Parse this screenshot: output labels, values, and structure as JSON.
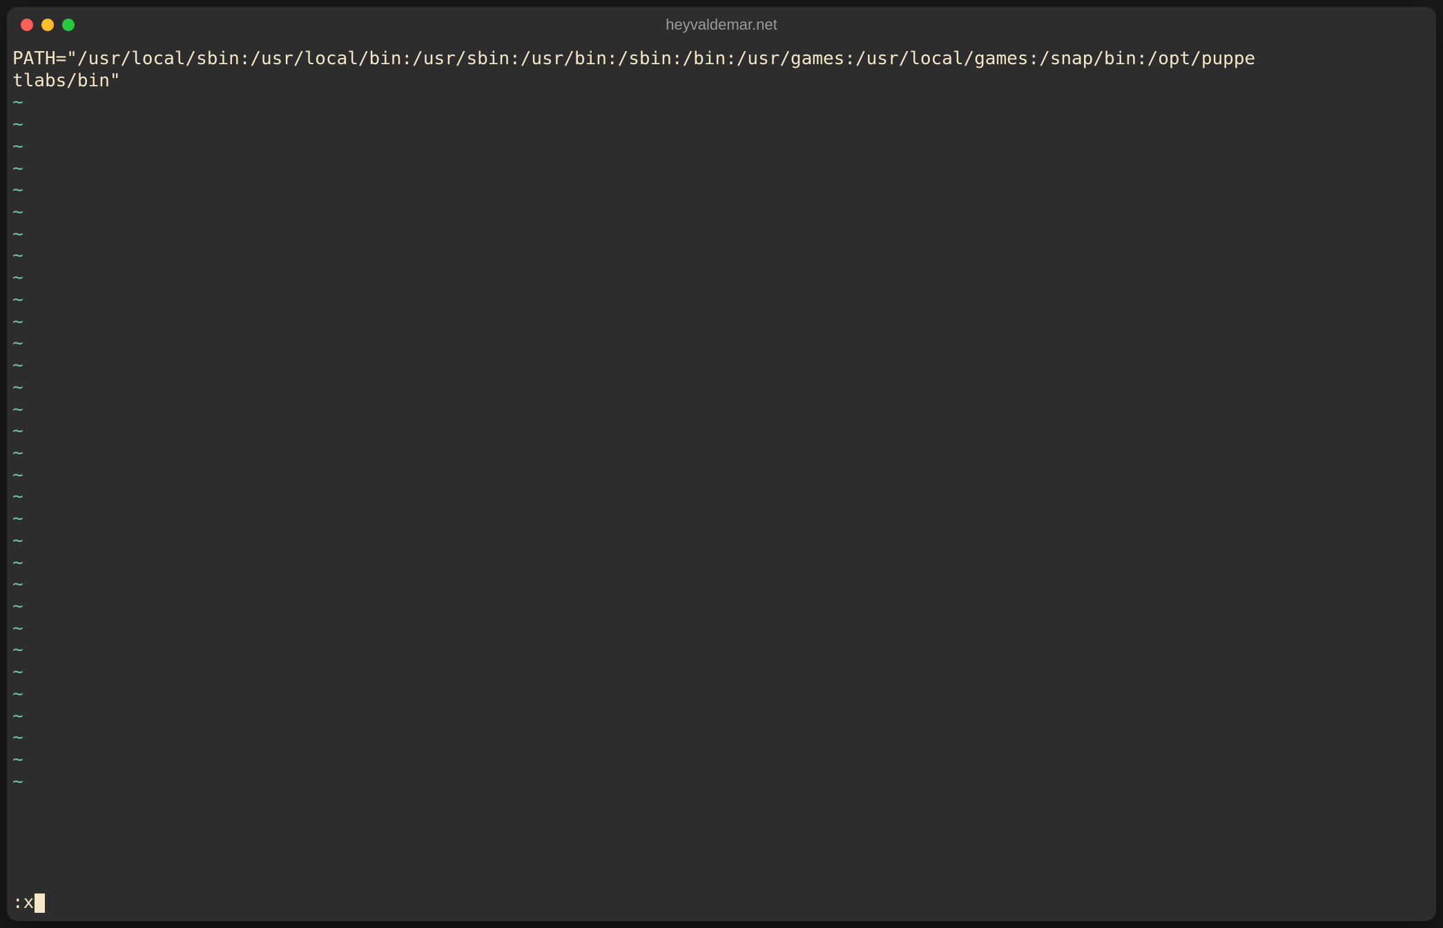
{
  "window": {
    "title": "heyvaldemar.net"
  },
  "editor": {
    "content_line1": "PATH=\"/usr/local/sbin:/usr/local/bin:/usr/sbin:/usr/bin:/sbin:/bin:/usr/games:/usr/local/games:/snap/bin:/opt/puppe",
    "content_line2": "tlabs/bin\"",
    "tilde_char": "~",
    "tilde_count": 32,
    "command": ":x"
  }
}
